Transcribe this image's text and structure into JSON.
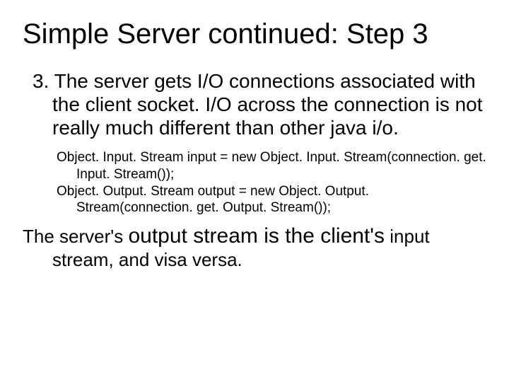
{
  "title": "Simple Server continued: Step 3",
  "para1": "3. The server gets I/O connections associated with the client socket.  I/O across the connection is not really much different than other java i/o.",
  "code": {
    "line1": "Object. Input. Stream input = new Object. Input. Stream(connection. get. Input. Stream());",
    "line2": "Object. Output. Stream output = new Object. Output. Stream(connection. get. Output. Stream());"
  },
  "closing_prefix": "The server's ",
  "closing_big": "output stream is the client's",
  "closing_rest": " input stream, and visa versa."
}
